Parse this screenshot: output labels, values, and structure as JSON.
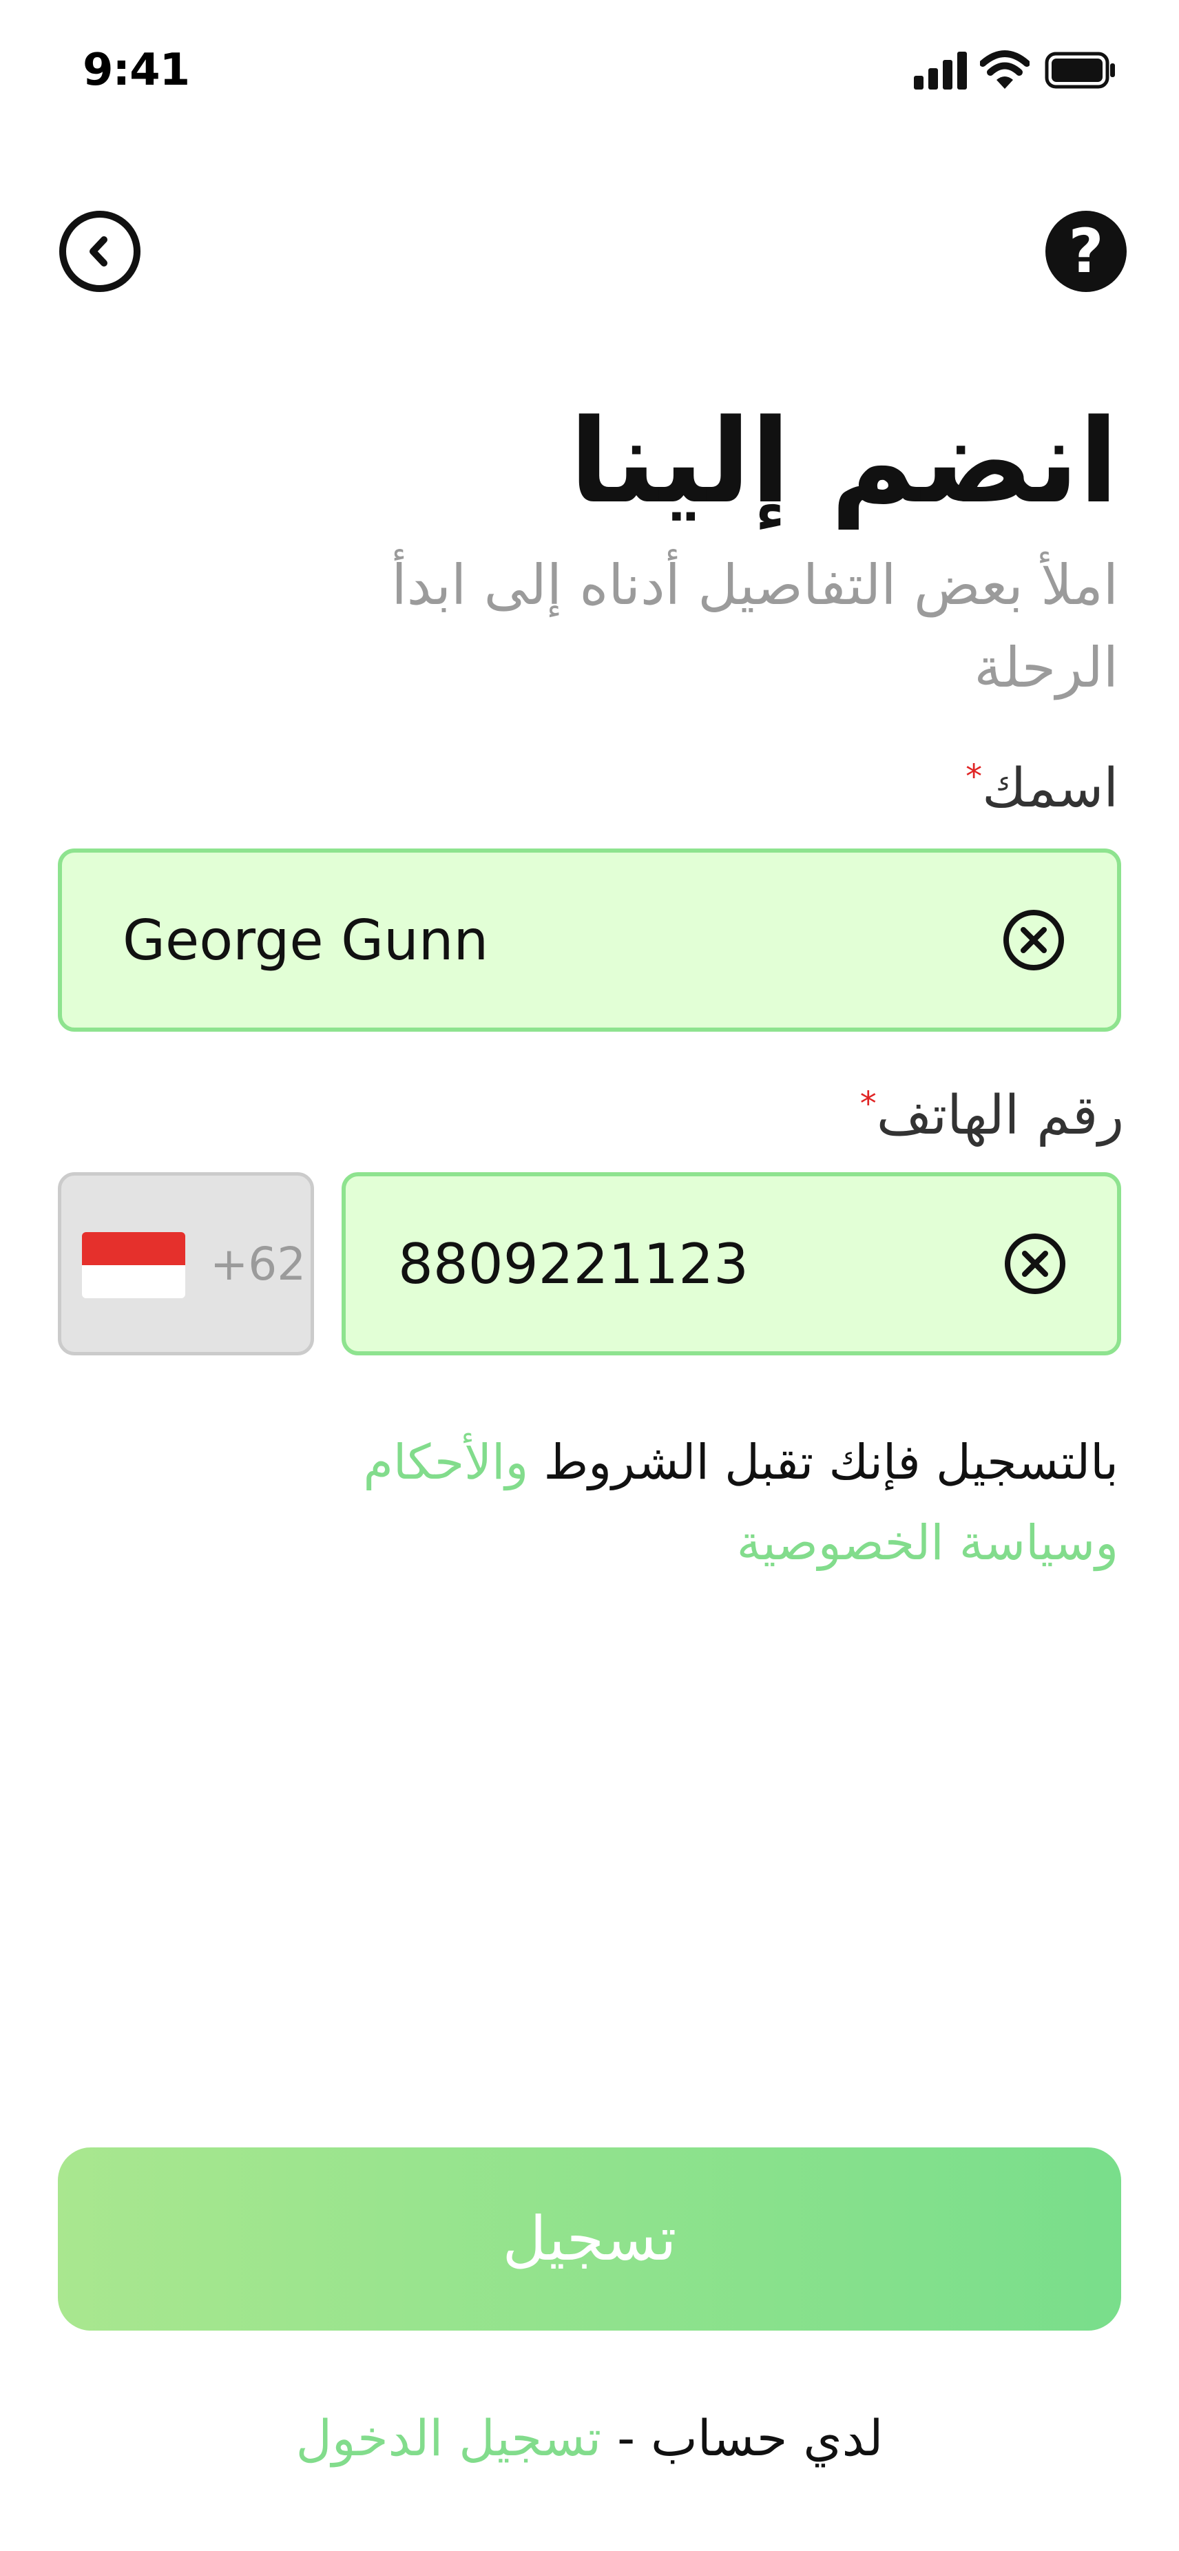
{
  "status_bar": {
    "time": "9:41",
    "icons": [
      "signal-icon",
      "wifi-icon",
      "battery-icon"
    ]
  },
  "nav": {
    "back_icon": "chevron-left-circle-icon",
    "help_icon": "question-circle-icon",
    "help_glyph": "?"
  },
  "heading": {
    "title": "انضم إلينا",
    "subtitle": "املأ بعض التفاصيل أدناه إلى ابدأ الرحلة"
  },
  "form": {
    "name": {
      "label": "اسمك",
      "required_mark": "*",
      "value": "George Gunn"
    },
    "phone": {
      "label": "رقم الهاتف",
      "required_mark": "*",
      "country_code": "+62",
      "country_flag": "indonesia-flag-icon",
      "value": "8809221123"
    }
  },
  "terms": {
    "prefix": "بالتسجيل فإنك تقبل الشروط ",
    "terms_link": "والأحكام",
    "privacy_link": "وسياسة الخصوصية"
  },
  "actions": {
    "register_label": "تسجيل"
  },
  "footer": {
    "have_account": "لدي حساب - ",
    "login_link": "تسجيل الدخول"
  },
  "colors": {
    "accent": "#82dc8c",
    "input_background": "#e2ffd6",
    "input_border": "#8ee38f",
    "required": "#e02424",
    "muted_text": "#9b9b9b"
  }
}
